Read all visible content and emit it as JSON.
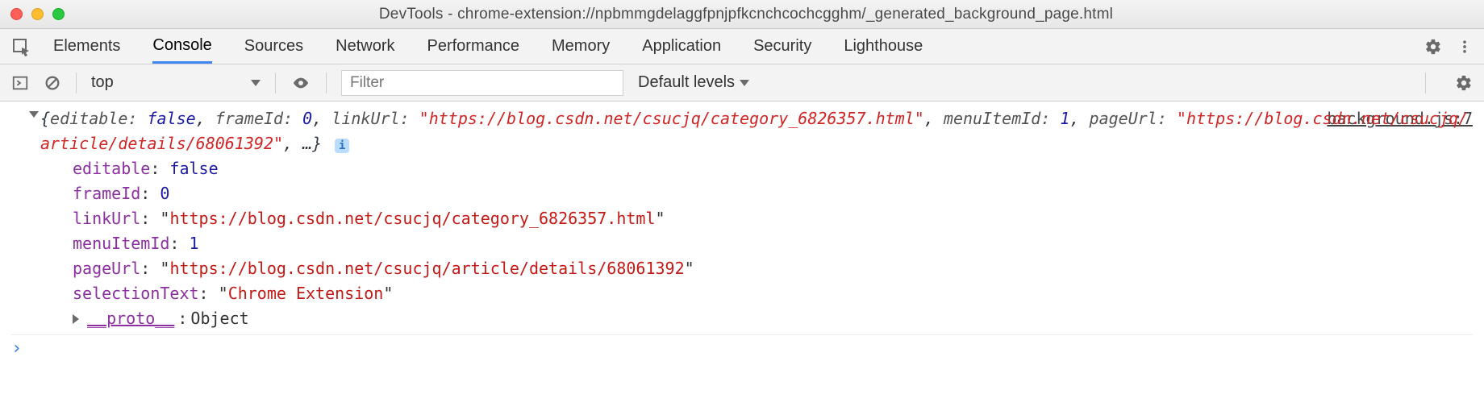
{
  "title": "DevTools - chrome-extension://npbmmgdelaggfpnjpfkcnchcochcgghm/_generated_background_page.html",
  "tabs": {
    "items": [
      "Elements",
      "Console",
      "Sources",
      "Network",
      "Performance",
      "Memory",
      "Application",
      "Security",
      "Lighthouse"
    ],
    "active_index": 1
  },
  "toolbar": {
    "context": "top",
    "filter_placeholder": "Filter",
    "filter_value": "",
    "levels": "Default levels"
  },
  "source_link": "background.js:7",
  "log": {
    "summary_parts": {
      "open": "{",
      "k0": "editable:",
      "v0": "false",
      "k1": "frameId:",
      "v1": "0",
      "k2": "linkUrl:",
      "v2": "\"https://blog.csdn.net/csucjq/category_6826357.html\"",
      "k3": "menuItemId:",
      "v3": "1",
      "k4": "pageUrl:",
      "v4": "\"https://blog.csdn.net/csucjq/article/details/68061392\"",
      "rest": ", …}",
      "info": "i"
    },
    "props": {
      "editable": {
        "k": "editable",
        "v": "false",
        "t": "bool"
      },
      "frameId": {
        "k": "frameId",
        "v": "0",
        "t": "num"
      },
      "linkUrl": {
        "k": "linkUrl",
        "v": "https://blog.csdn.net/csucjq/category_6826357.html",
        "t": "str"
      },
      "menuItemId": {
        "k": "menuItemId",
        "v": "1",
        "t": "num"
      },
      "pageUrl": {
        "k": "pageUrl",
        "v": "https://blog.csdn.net/csucjq/article/details/68061392",
        "t": "str"
      },
      "selectionText": {
        "k": "selectionText",
        "v": "Chrome Extension",
        "t": "str"
      }
    },
    "proto_key": "__proto__",
    "proto_val": "Object"
  },
  "prompt": "›"
}
